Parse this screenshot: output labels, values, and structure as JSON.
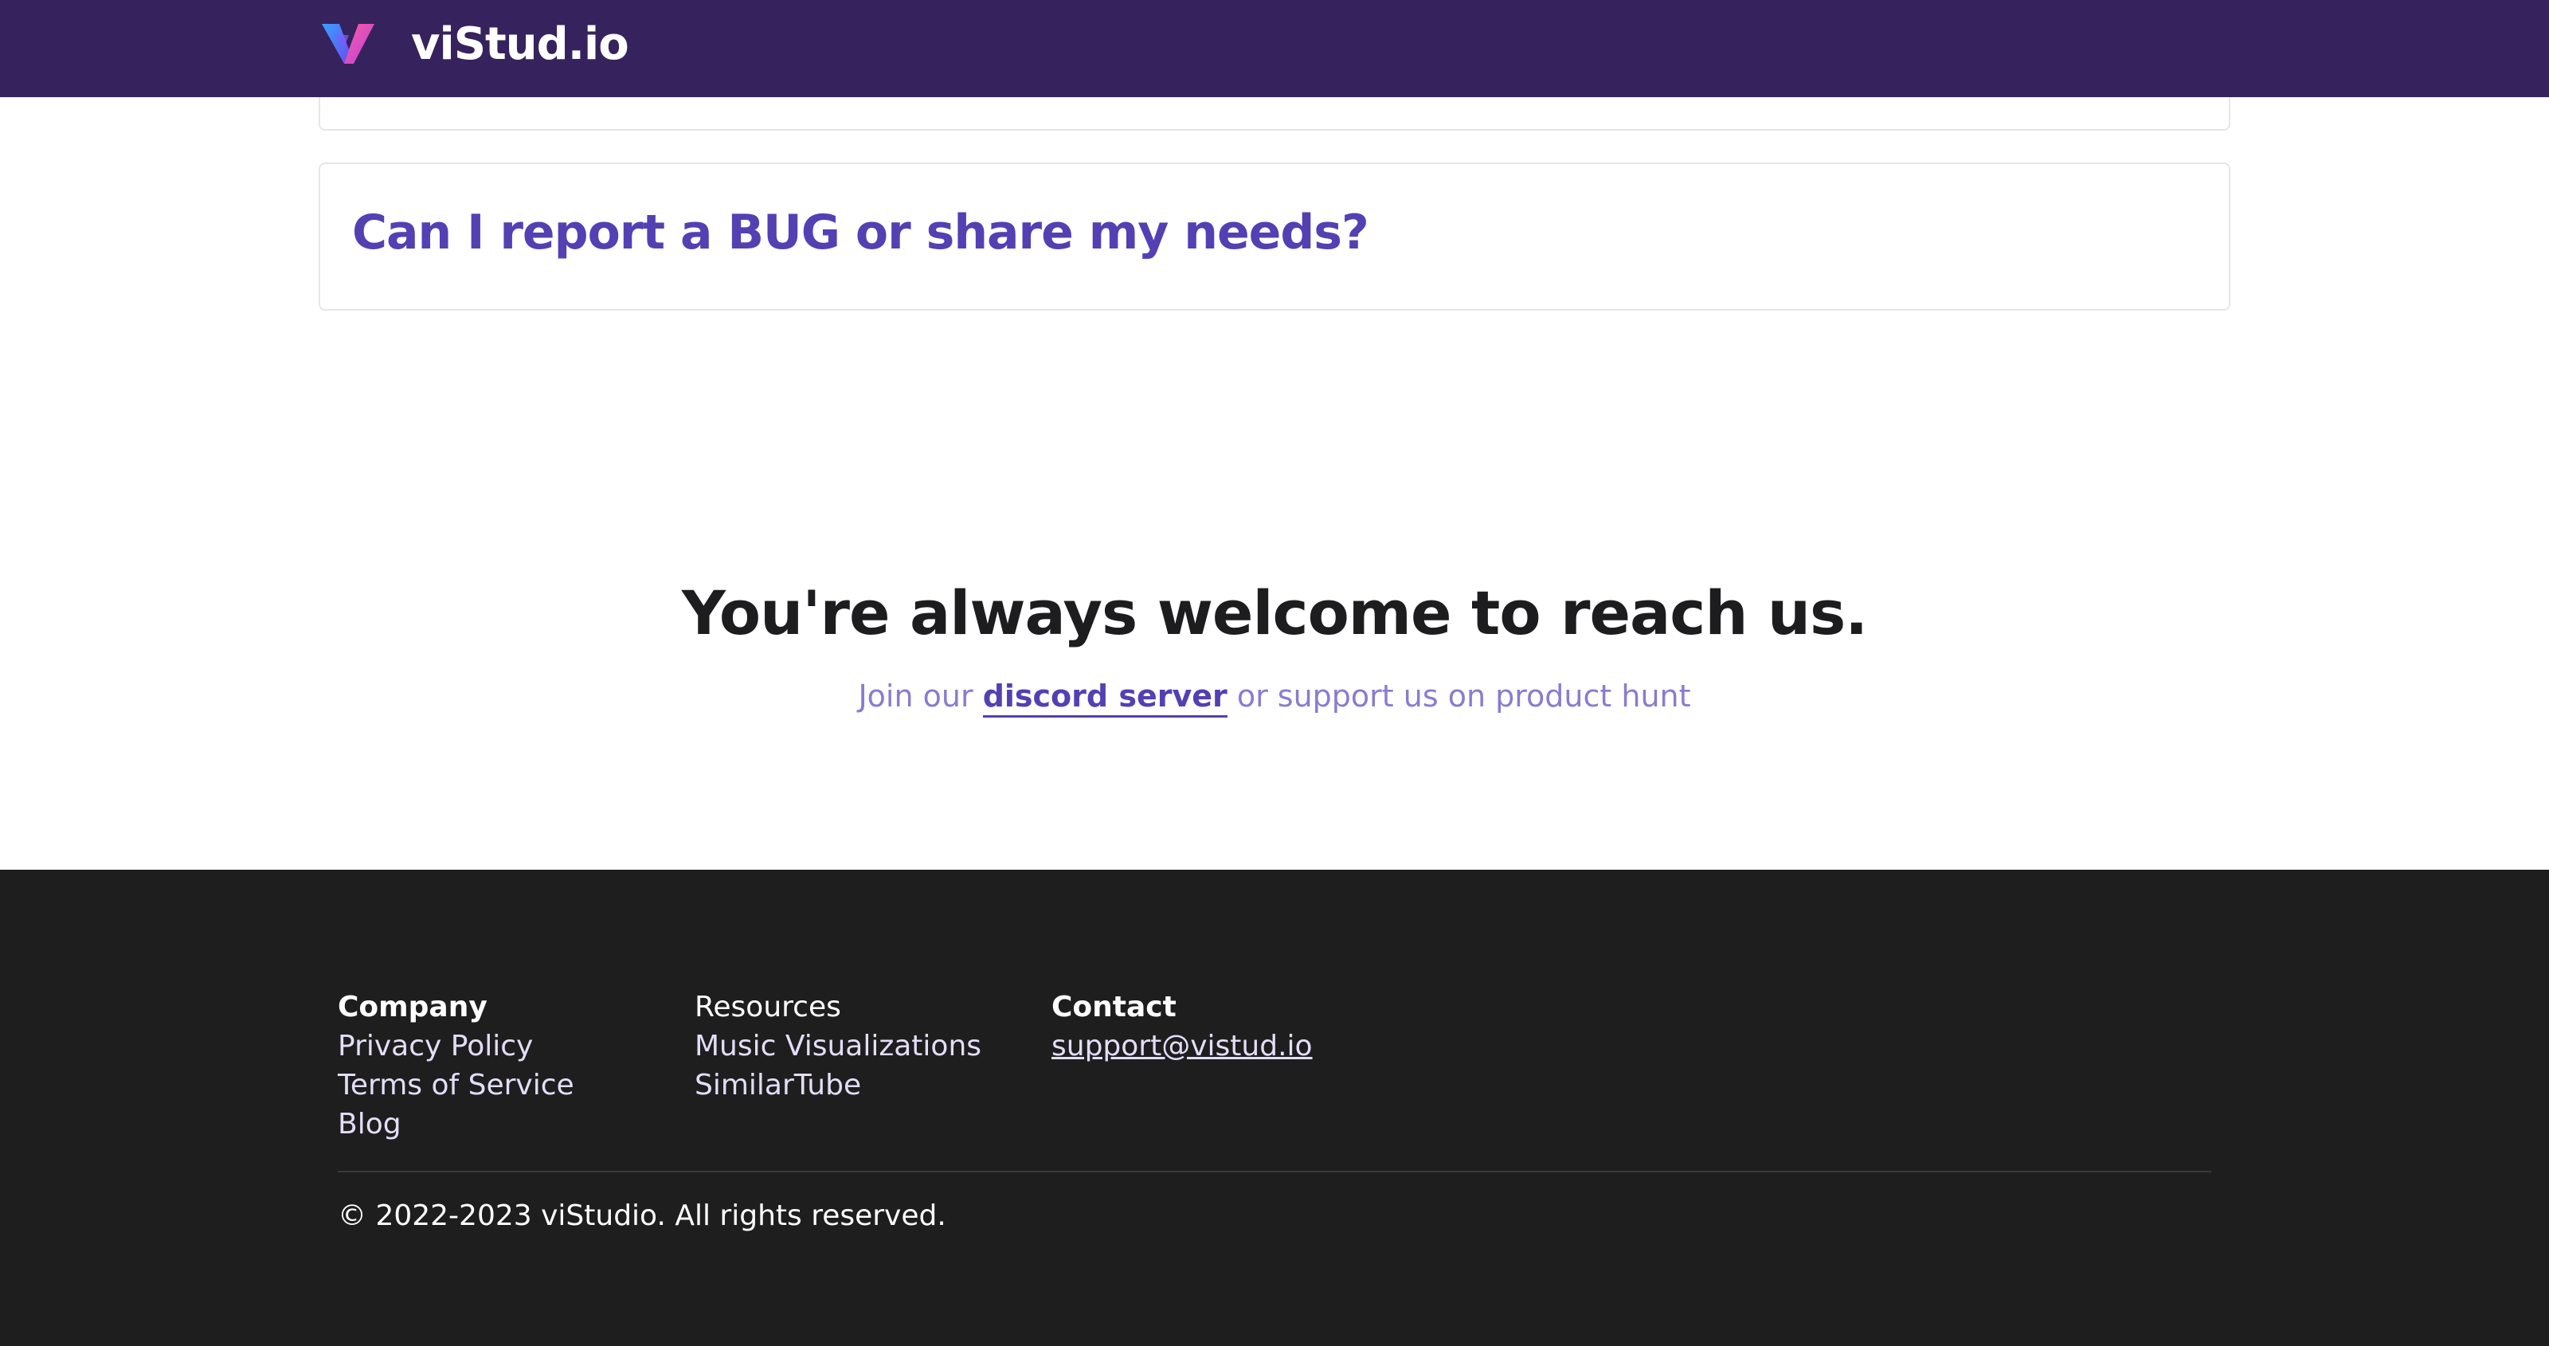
{
  "header": {
    "brand": "viStud.io",
    "logo_icon": "vistudio-v-logo-icon",
    "background_color": "#36225c"
  },
  "faq": {
    "question": "Can I report a BUG or share my needs?",
    "question_color": "#5340b3"
  },
  "reach": {
    "title": "You're always welcome to reach us.",
    "sub_before": "Join our ",
    "discord_label": "discord server",
    "sub_after": " or support us on product hunt",
    "sub_color": "#8a7ccf"
  },
  "footer": {
    "background_color": "#1e1e1e",
    "company": {
      "heading": "Company",
      "links": [
        "Privacy Policy",
        "Terms of Service",
        "Blog"
      ]
    },
    "resources": {
      "heading": "Resources",
      "links": [
        "Music Visualizations",
        "SimilarTube"
      ]
    },
    "contact": {
      "heading": "Contact",
      "email": "support@vistud.io"
    },
    "copyright": "© 2022-2023 viStudio. All rights reserved."
  }
}
